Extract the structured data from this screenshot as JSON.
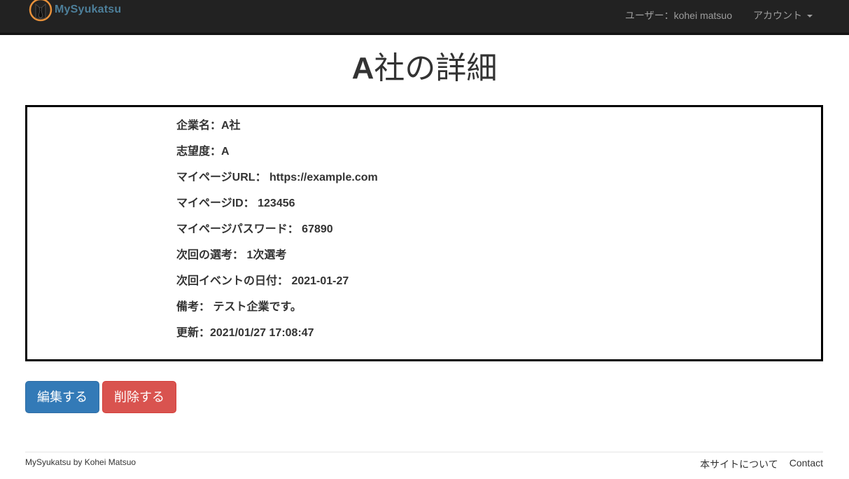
{
  "navbar": {
    "brand": "MySyukatsu",
    "logo_icon": "tie-person-icon",
    "user_label": "ユーザー：kohei matsuo",
    "account_label": "アカウント",
    "background": "#222222",
    "brand_color": "#4d7f9a"
  },
  "page": {
    "title_strong": "A",
    "title_rest": "社の詳細"
  },
  "details": {
    "rows": [
      "企業名：A社",
      "志望度：A",
      "マイページURL： https://example.com",
      "マイページID： 123456",
      "マイページパスワード： 67890",
      "次回の選考： 1次選考",
      "次回イベントの日付： 2021-01-27",
      "備考： テスト企業です。",
      "更新：2021/01/27 17:08:47"
    ]
  },
  "actions": {
    "edit_label": "編集する",
    "delete_label": "削除する",
    "edit_color": "#337ab7",
    "delete_color": "#d9534f"
  },
  "footer": {
    "credit": "MySyukatsu by Kohei Matsuo",
    "about_link": "本サイトについて",
    "contact_link": "Contact"
  }
}
